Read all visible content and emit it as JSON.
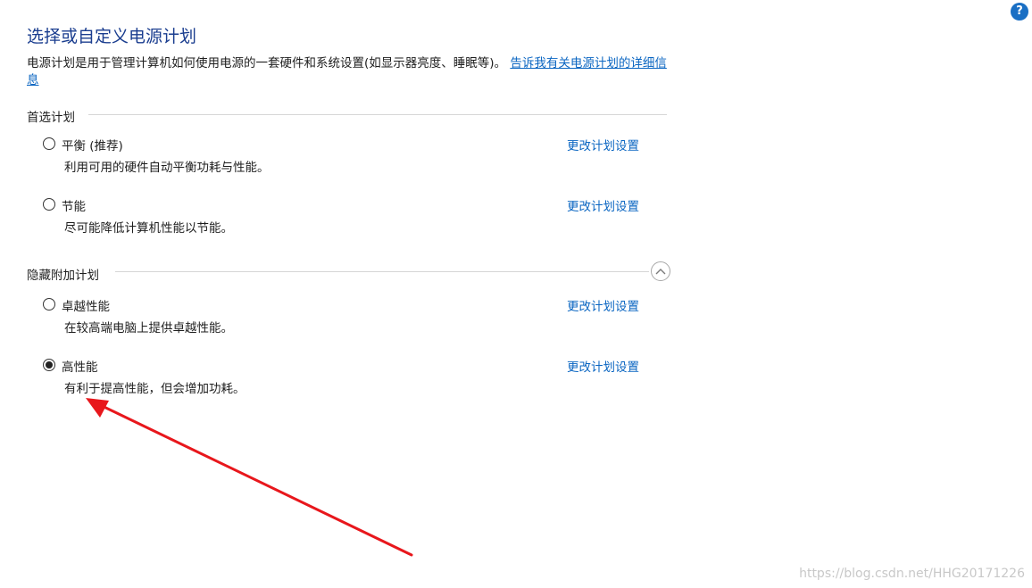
{
  "page": {
    "title": "选择或自定义电源计划",
    "help_icon": "question-mark-icon",
    "intro_text": "电源计划是用于管理计算机如何使用电源的一套硬件和系统设置(如显示器亮度、睡眠等)。",
    "intro_link": "告诉我有关电源计划的详细信息"
  },
  "preferred": {
    "heading": "首选计划",
    "plans": [
      {
        "name": "平衡 (推荐)",
        "desc": "利用可用的硬件自动平衡功耗与性能。",
        "link": "更改计划设置",
        "selected": false
      },
      {
        "name": "节能",
        "desc": "尽可能降低计算机性能以节能。",
        "link": "更改计划设置",
        "selected": false
      }
    ]
  },
  "hidden": {
    "heading": "隐藏附加计划",
    "collapse_icon": "chevron-up-icon",
    "plans": [
      {
        "name": "卓越性能",
        "desc": "在较高端电脑上提供卓越性能。",
        "link": "更改计划设置",
        "selected": false
      },
      {
        "name": "高性能",
        "desc": "有利于提高性能，但会增加功耗。",
        "link": "更改计划设置",
        "selected": true
      }
    ]
  },
  "annotation": {
    "arrow_color": "#e8171c"
  },
  "watermark": "https://blog.csdn.net/HHG20171226"
}
